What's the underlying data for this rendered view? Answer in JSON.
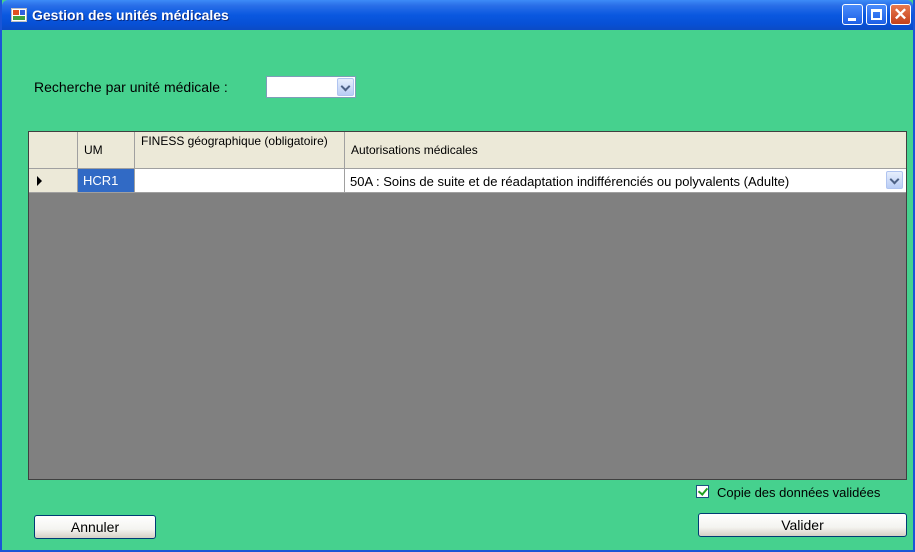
{
  "window": {
    "title": "Gestion des unités médicales",
    "controls": [
      "minimize-icon",
      "maximize-icon",
      "close-icon"
    ],
    "background_color": "#46d18e",
    "titlebar_color": "#0a58e0"
  },
  "search": {
    "label": "Recherche par unité médicale :",
    "selected_value": ""
  },
  "grid": {
    "columns": [
      "UM",
      "FINESS géographique (obligatoire)",
      "Autorisations médicales"
    ],
    "rows": [
      {
        "um": "HCR1",
        "finess": "",
        "autorisation": "50A : Soins de suite et de réadaptation indifférenciés ou polyvalents (Adulte)",
        "current": true
      }
    ],
    "selected_cell_color": "#316ac5"
  },
  "options": {
    "copy_label": "Copie des données validées",
    "copy_checked": true
  },
  "buttons": {
    "cancel_label": "Annuler",
    "validate_label": "Valider"
  }
}
